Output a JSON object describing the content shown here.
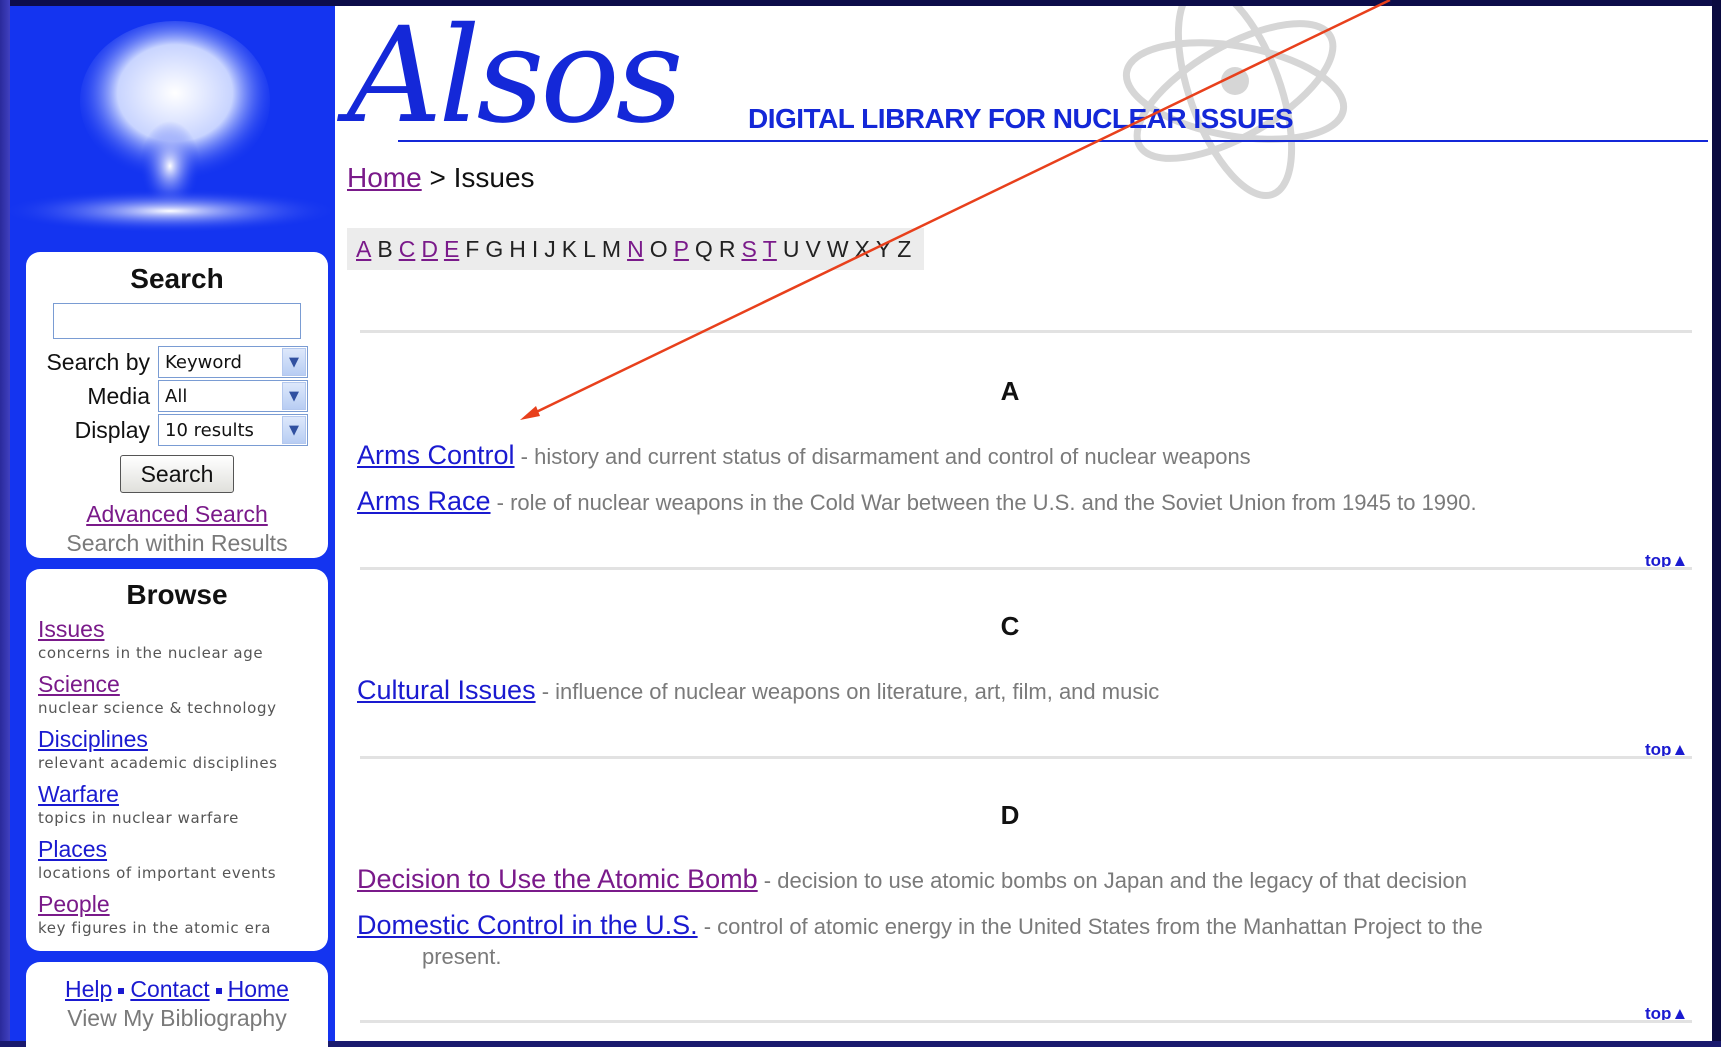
{
  "site": {
    "logo": "Alsos",
    "tagline": "DIGITAL LIBRARY FOR NUCLEAR ISSUES"
  },
  "breadcrumb": {
    "home": "Home",
    "separator": " > ",
    "current": "Issues"
  },
  "alphabet": [
    {
      "l": "A",
      "linked": true
    },
    {
      "l": "B",
      "linked": false
    },
    {
      "l": "C",
      "linked": true
    },
    {
      "l": "D",
      "linked": true
    },
    {
      "l": "E",
      "linked": true
    },
    {
      "l": "F",
      "linked": false
    },
    {
      "l": "G",
      "linked": false
    },
    {
      "l": "H",
      "linked": false
    },
    {
      "l": "I",
      "linked": false
    },
    {
      "l": "J",
      "linked": false
    },
    {
      "l": "K",
      "linked": false
    },
    {
      "l": "L",
      "linked": false
    },
    {
      "l": "M",
      "linked": false
    },
    {
      "l": "N",
      "linked": true
    },
    {
      "l": "O",
      "linked": false
    },
    {
      "l": "P",
      "linked": true
    },
    {
      "l": "Q",
      "linked": false
    },
    {
      "l": "R",
      "linked": false
    },
    {
      "l": "S",
      "linked": true
    },
    {
      "l": "T",
      "linked": true
    },
    {
      "l": "U",
      "linked": false
    },
    {
      "l": "V",
      "linked": false
    },
    {
      "l": "W",
      "linked": false
    },
    {
      "l": "X",
      "linked": false
    },
    {
      "l": "Y",
      "linked": false
    },
    {
      "l": "Z",
      "linked": false
    }
  ],
  "search": {
    "title": "Search",
    "input_value": "",
    "search_by_label": "Search by",
    "search_by_value": "Keyword",
    "media_label": "Media",
    "media_value": "All",
    "display_label": "Display",
    "display_value": "10 results",
    "button": "Search",
    "advanced": "Advanced Search",
    "within": "Search within Results"
  },
  "browse": {
    "title": "Browse",
    "items": [
      {
        "label": "Issues",
        "desc": "concerns in the nuclear age"
      },
      {
        "label": "Science",
        "desc": "nuclear science & technology"
      },
      {
        "label": "Disciplines",
        "desc": "relevant academic disciplines"
      },
      {
        "label": "Warfare",
        "desc": "topics in nuclear warfare"
      },
      {
        "label": "Places",
        "desc": "locations of important events"
      },
      {
        "label": "People",
        "desc": "key figures in the atomic era"
      }
    ]
  },
  "footer": {
    "help": "Help",
    "contact": "Contact",
    "home": "Home",
    "bibliography": "View My Bibliography"
  },
  "sections": [
    {
      "letter": "A",
      "entries": [
        {
          "title": "Arms Control",
          "desc": " - history and current status of disarmament and control of nuclear weapons"
        },
        {
          "title": "Arms Race",
          "desc": " - role of nuclear weapons in the Cold War between the U.S. and the Soviet Union from 1945 to 1990."
        }
      ]
    },
    {
      "letter": "C",
      "entries": [
        {
          "title": "Cultural Issues",
          "desc": " - influence of nuclear weapons on literature, art, film, and music"
        }
      ]
    },
    {
      "letter": "D",
      "entries": [
        {
          "title": "Decision to Use the Atomic Bomb",
          "desc": " - decision to use atomic bombs on Japan and the legacy of that decision"
        },
        {
          "title": "Domestic Control in the U.S.",
          "desc": " - control of atomic energy in the United States from the Manhattan Project to the",
          "cont": "present."
        }
      ]
    }
  ],
  "top_label": "top",
  "colors": {
    "sidebar": "#1434f0",
    "brand": "#1428d8",
    "visited": "#7a1a8a",
    "link": "#1a1ad0",
    "annotation": "#e8401c"
  }
}
